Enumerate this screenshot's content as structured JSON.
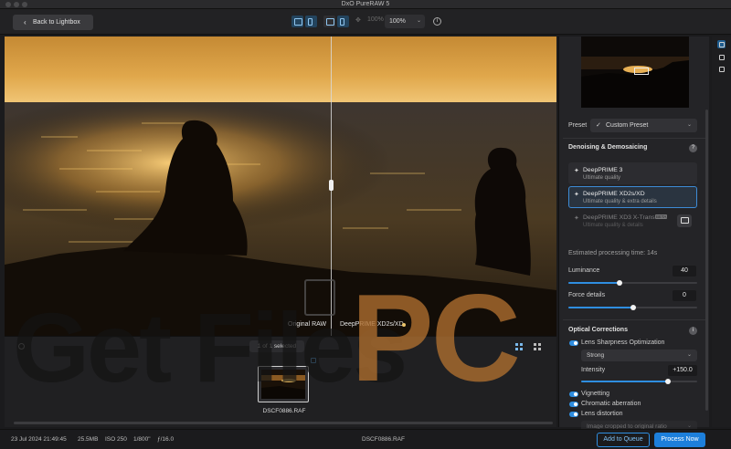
{
  "window": {
    "title": "DxO PureRAW 5"
  },
  "toolbar": {
    "back_label": "Back to Lightbox",
    "zoom_fit_label": "100%",
    "zoom_value": "100%"
  },
  "viewer": {
    "left_label": "Original RAW",
    "right_label": "DeepPRIME XD2s/XD"
  },
  "filmstrip": {
    "selected_text": "1 of 1 selected",
    "file_name": "DSCF0886.RAF"
  },
  "status": {
    "date": "23 Jul 2024 21:49:45",
    "size": "25.5MB",
    "iso": "ISO 250",
    "shutter": "1/800\"",
    "aperture": "ƒ/16.0",
    "file_name": "DSCF0886.RAF",
    "add_queue_label": "Add to Queue",
    "process_label": "Process Now"
  },
  "panel": {
    "preset_label": "Preset",
    "preset_value": "Custom Preset",
    "denoise_heading": "Denoising & Demosaicing",
    "modes": [
      {
        "title": "DeepPRIME 3",
        "subtitle": "Ultimate quality"
      },
      {
        "title": "DeepPRIME XD2s/XD",
        "subtitle": "Ultimate quality & extra details"
      },
      {
        "title": "DeepPRIME XD3 X-Trans",
        "subtitle": "Ultimate quality & details",
        "badge": "BETA"
      }
    ],
    "processing_time": "Estimated processing time: 14s",
    "luminance_label": "Luminance",
    "luminance_value": "40",
    "force_label": "Force details",
    "force_value": "0",
    "optical_heading": "Optical Corrections",
    "lens_sharpness_label": "Lens Sharpness Optimization",
    "lens_sharpness_mode": "Strong",
    "intensity_label": "Intensity",
    "intensity_value": "+150.0",
    "vignetting_label": "Vignetting",
    "chromatic_label": "Chromatic aberration",
    "distortion_label": "Lens distortion",
    "distortion_mode": "Image cropped to original ratio"
  },
  "watermark": {
    "left": "Get Files",
    "right": "PC"
  },
  "colors": {
    "accent": "#2f8ee0",
    "primary_button": "#1d7fdb",
    "panel_bg": "#242427"
  },
  "sliders": {
    "luminance": 0.4,
    "force_details": 0.5,
    "intensity": 0.75
  }
}
